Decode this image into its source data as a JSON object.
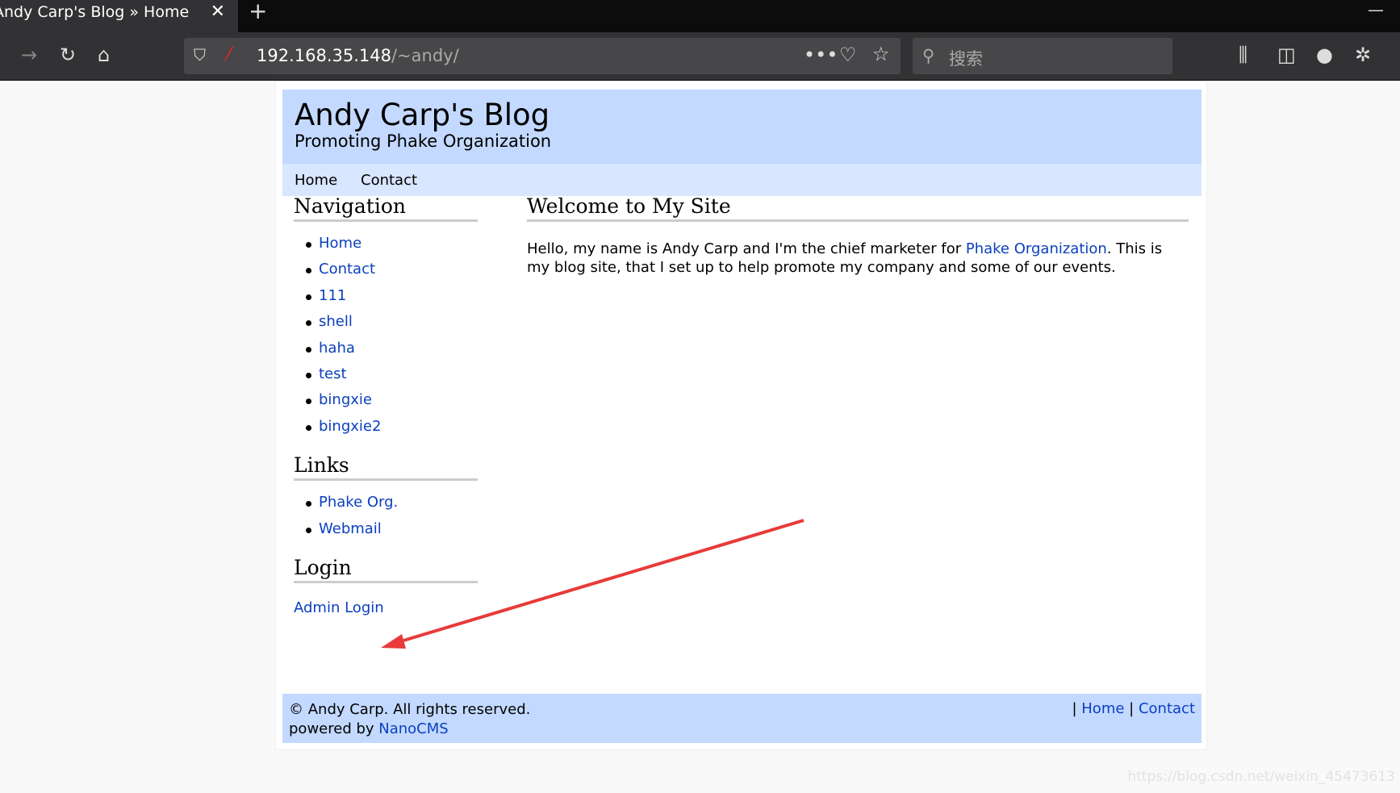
{
  "browser": {
    "tab_title": "Andy Carp's Blog » Home",
    "url_host": "192.168.35.148",
    "url_path": "/~andy/",
    "search_placeholder": "搜索"
  },
  "header": {
    "title": "Andy Carp's Blog",
    "subtitle": "Promoting Phake Organization"
  },
  "menu": [
    "Home",
    "Contact"
  ],
  "sidebar": {
    "navigation": {
      "title": "Navigation",
      "items": [
        "Home",
        "Contact",
        "111",
        "shell",
        "haha",
        "test",
        "bingxie",
        "bingxie2"
      ]
    },
    "links": {
      "title": "Links",
      "items": [
        "Phake Org.",
        "Webmail"
      ]
    },
    "login": {
      "title": "Login",
      "link": "Admin Login"
    }
  },
  "main": {
    "title": "Welcome to My Site",
    "text_before": "Hello, my name is Andy Carp and I'm the chief marketer for ",
    "link": "Phake Organization",
    "text_after": ". This is my blog site, that I set up to help promote my company and some of our events."
  },
  "footer": {
    "copyright": "© Andy Carp. All rights reserved.",
    "powered": "powered by ",
    "powered_link": "NanoCMS",
    "links": [
      "Home",
      "Contact"
    ],
    "separator": "|"
  },
  "watermark": "https://blog.csdn.net/weixin_45473613",
  "colors": {
    "header_bg": "#c3d9ff",
    "menu_bg": "#d9e6ff",
    "link": "#0b3fbf",
    "arrow": "#e83a3a"
  }
}
